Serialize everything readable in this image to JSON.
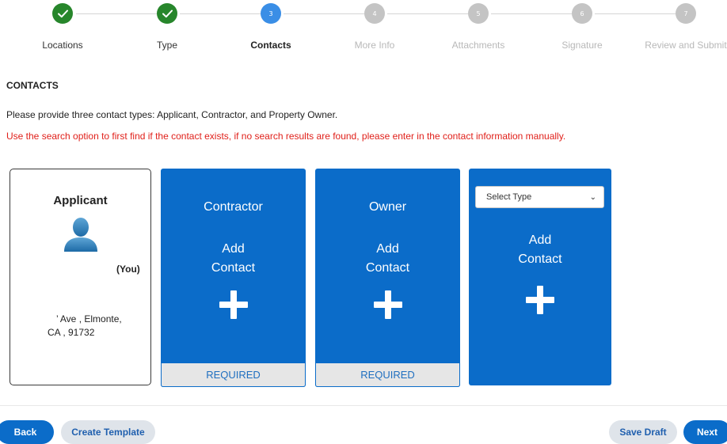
{
  "stepper": {
    "steps": [
      {
        "number": "1",
        "label": "Locations",
        "status": "done"
      },
      {
        "number": "2",
        "label": "Type",
        "status": "done"
      },
      {
        "number": "3",
        "label": "Contacts",
        "status": "active"
      },
      {
        "number": "4",
        "label": "More Info",
        "status": "todo"
      },
      {
        "number": "5",
        "label": "Attachments",
        "status": "todo"
      },
      {
        "number": "6",
        "label": "Signature",
        "status": "todo"
      },
      {
        "number": "7",
        "label": "Review and Submit",
        "status": "todo"
      }
    ],
    "check_icon": "check-icon"
  },
  "section": {
    "title": "CONTACTS",
    "instructions": "Please provide three contact types: Applicant, Contractor, and Property Owner.",
    "warning": "Use the search option to first find if the contact exists, if no search results are found, please enter in the contact information manually."
  },
  "cards": {
    "applicant": {
      "title": "Applicant",
      "you_label": "(You)",
      "address_line1": "’ Ave , Elmonte,",
      "address_line2": "CA , 91732",
      "avatar_icon": "user-avatar-icon"
    },
    "contractor": {
      "title": "Contractor",
      "add_line1": "Add",
      "add_line2": "Contact",
      "required_label": "REQUIRED"
    },
    "owner": {
      "title": "Owner",
      "add_line1": "Add",
      "add_line2": "Contact",
      "required_label": "REQUIRED"
    },
    "other": {
      "select_value": "Select Type",
      "add_line1": "Add",
      "add_line2": "Contact"
    }
  },
  "footer": {
    "back": "Back",
    "create_template": "Create Template",
    "save_draft": "Save Draft",
    "next": "Next"
  },
  "colors": {
    "step_done": "#27862b",
    "step_active": "#3a8ee6",
    "step_todo": "#c4c4c4",
    "primary": "#0b6cc9",
    "warning": "#e0201a"
  }
}
